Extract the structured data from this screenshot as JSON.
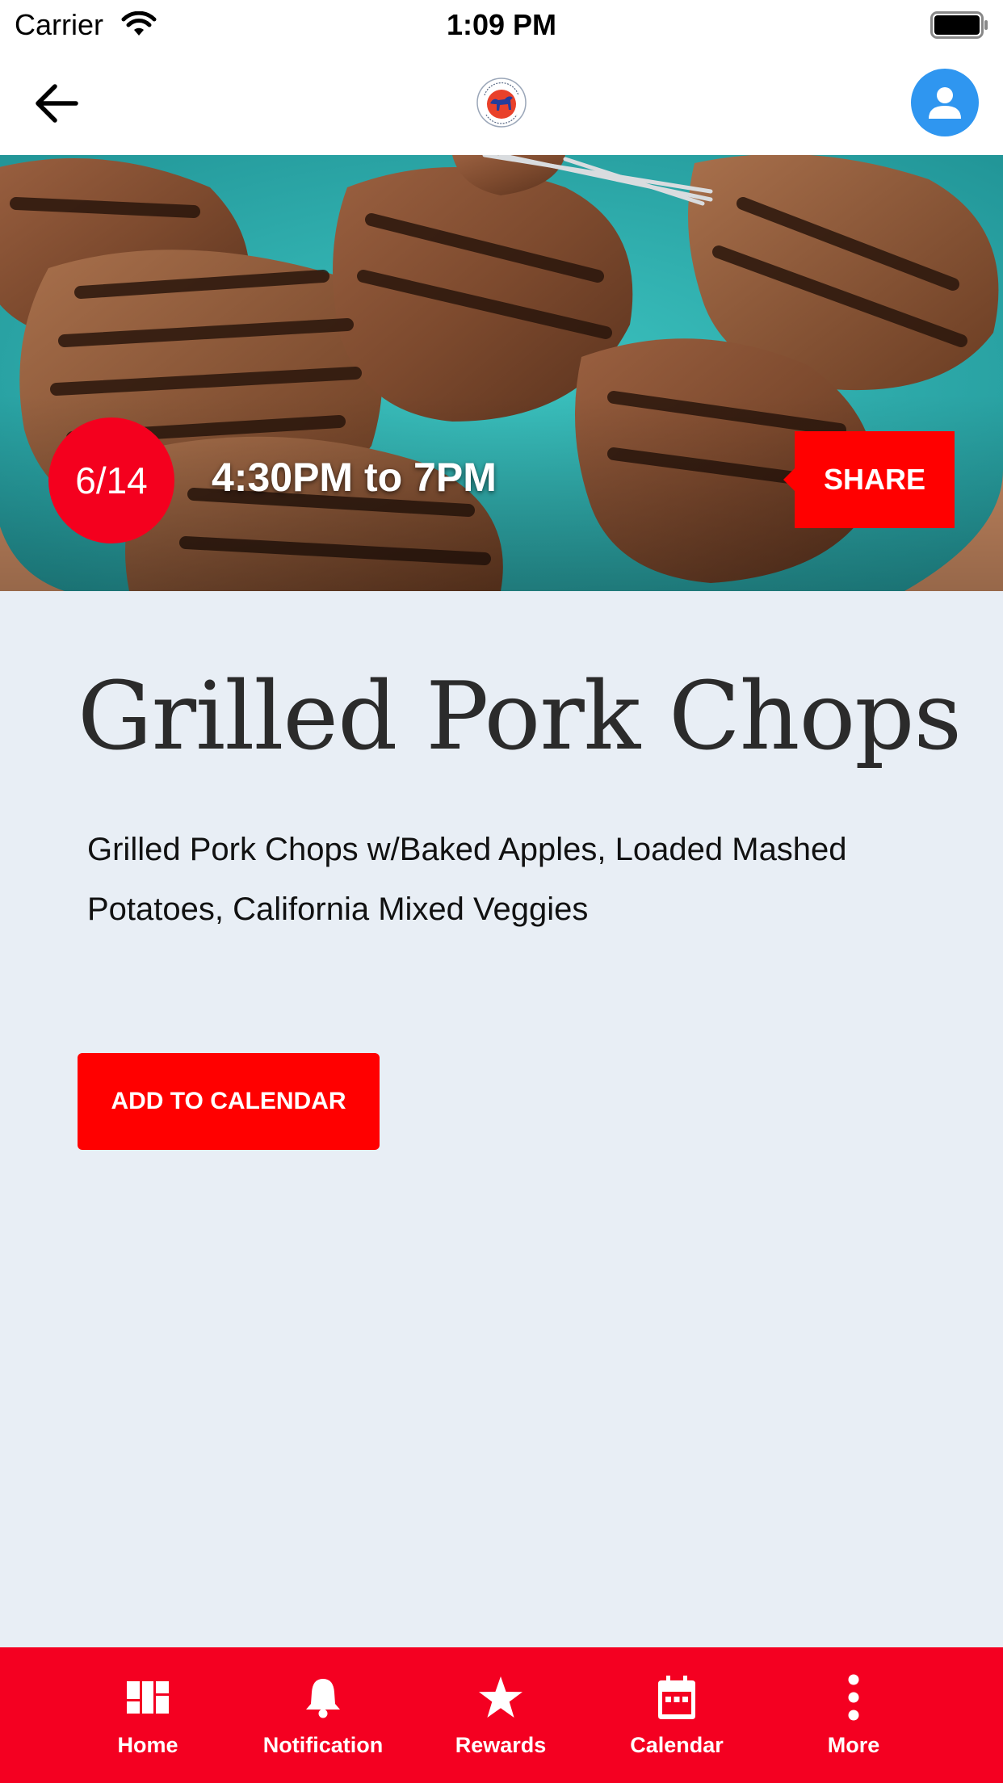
{
  "status_bar": {
    "carrier": "Carrier",
    "time": "1:09 PM"
  },
  "nav": {
    "back_icon": "arrow-left-icon",
    "logo_icon": "lodge-logo-icon",
    "profile_icon": "user-icon"
  },
  "event": {
    "date": "6/14",
    "time_range": "4:30PM to 7PM",
    "share_label": "SHARE",
    "title": "Grilled Pork Chops",
    "description": "Grilled Pork Chops w/Baked Apples, Loaded Mashed Potatoes, California Mixed Veggies",
    "add_to_calendar_label": "ADD TO CALENDAR"
  },
  "tabs": [
    {
      "label": "Home",
      "icon": "dashboard-icon"
    },
    {
      "label": "Notification",
      "icon": "bell-icon"
    },
    {
      "label": "Rewards",
      "icon": "star-icon"
    },
    {
      "label": "Calendar",
      "icon": "calendar-icon"
    },
    {
      "label": "More",
      "icon": "more-vertical-icon"
    }
  ],
  "colors": {
    "accent_red": "#f40021",
    "profile_blue": "#2f96f0",
    "background": "#e8eef5"
  }
}
